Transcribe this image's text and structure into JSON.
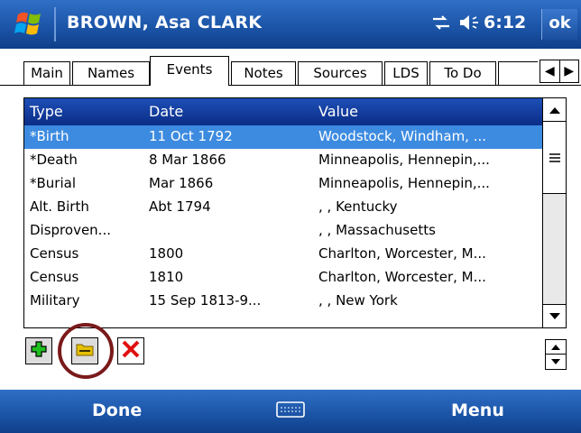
{
  "titlebar": {
    "title": "BROWN, Asa CLARK",
    "time": "6:12",
    "ok": "ok",
    "icons": [
      "start-logo",
      "connectivity-icon",
      "volume-icon"
    ]
  },
  "tabs": {
    "items": [
      "Main",
      "Names",
      "Events",
      "Notes",
      "Sources",
      "LDS",
      "To Do"
    ],
    "active": "Events"
  },
  "table": {
    "columns": [
      "Type",
      "Date",
      "Value"
    ],
    "rows": [
      {
        "type": "*Birth",
        "date": "11 Oct 1792",
        "value": "Woodstock, Windham, ...",
        "selected": true
      },
      {
        "type": "*Death",
        "date": "8 Mar 1866",
        "value": "Minneapolis, Hennepin,..."
      },
      {
        "type": "*Burial",
        "date": "Mar 1866",
        "value": "Minneapolis, Hennepin,..."
      },
      {
        "type": "Alt. Birth",
        "date": "Abt 1794",
        "value": ", , Kentucky"
      },
      {
        "type": "Disproven...",
        "date": "",
        "value": ", , Massachusetts"
      },
      {
        "type": "Census",
        "date": "1800",
        "value": "Charlton, Worcester, M..."
      },
      {
        "type": "Census",
        "date": "1810",
        "value": "Charlton, Worcester, M..."
      },
      {
        "type": "Military",
        "date": "15 Sep 1813-9...",
        "value": ", , New York"
      }
    ]
  },
  "toolbar": {
    "icons": [
      "add-icon",
      "edit-icon",
      "delete-icon"
    ]
  },
  "softkeys": {
    "left": "Done",
    "right": "Menu"
  },
  "colors": {
    "titlebar": "#1c55a8",
    "header": "#0a2d86",
    "selected_row": "#3d8be0",
    "highlight_circle": "#7a1a1a"
  }
}
